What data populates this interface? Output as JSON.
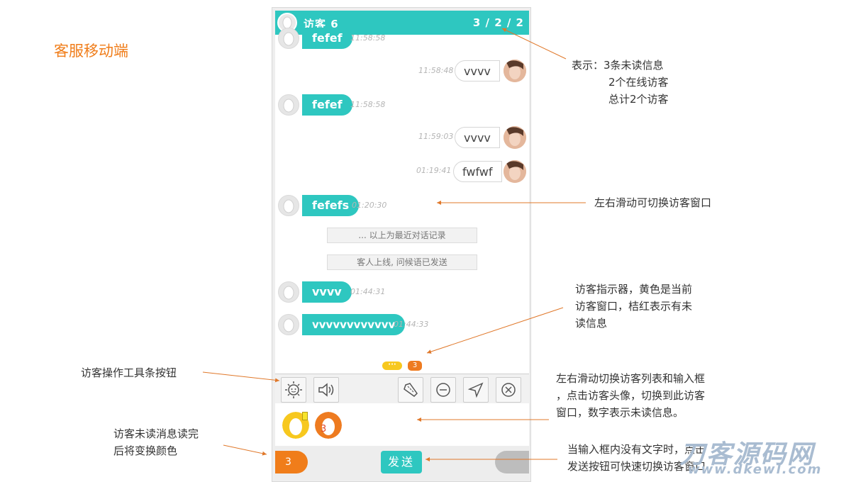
{
  "page_title": "客服移动端",
  "header": {
    "title": "访客 6",
    "counts": "3 / 2 / 2"
  },
  "messages": {
    "m1": {
      "text": "fefef",
      "time": "11:58:58"
    },
    "m2": {
      "text": "vvvv",
      "time": "11:58:48"
    },
    "m3": {
      "text": "fefef",
      "time": "11:58:58"
    },
    "m4": {
      "text": "vvvv",
      "time": "11:59:03"
    },
    "m5": {
      "text": "fwfwf",
      "time": "01:19:41"
    },
    "m6": {
      "text": "fefefs",
      "time": "01:20:30"
    },
    "m7": {
      "text": "vvvv",
      "time": "01:44:31"
    },
    "m8": {
      "text": "vvvvvvvvvvvv",
      "time": "01:44:33"
    }
  },
  "notices": {
    "history": "... 以上为最近对话记录",
    "online": "客人上线, 问候语已发送"
  },
  "indicators": {
    "current": "···",
    "unread": "3"
  },
  "visitor_list": {
    "unread_count": "3"
  },
  "input_bar": {
    "unread_label": "3",
    "send_label": "发送"
  },
  "annotations": {
    "a1": [
      "表示：3条未读信息",
      "2个在线访客",
      "总计2个访客"
    ],
    "a2": "左右滑动可切换访客窗口",
    "a3": [
      "访客指示器，黄色是当前",
      "访客窗口，桔红表示有未",
      "读信息"
    ],
    "a4": "访客操作工具条按钮",
    "a5": [
      "左右滑动切换访客列表和输入框",
      "，点击访客头像，切换到此访客",
      "窗口，数字表示未读信息。"
    ],
    "a6": [
      "访客未读消息读完",
      "后将变换颜色"
    ],
    "a7": [
      "当输入框内没有文字时，点击",
      "发送按钮可快速切换访客窗口"
    ]
  },
  "watermark": {
    "line1": "刀客源码网",
    "line2": "www.dkewl.com"
  },
  "colors": {
    "teal": "#2ec7c0",
    "orange": "#f07d1a",
    "yellow": "#f7c81e",
    "arrow": "#e0782a"
  }
}
